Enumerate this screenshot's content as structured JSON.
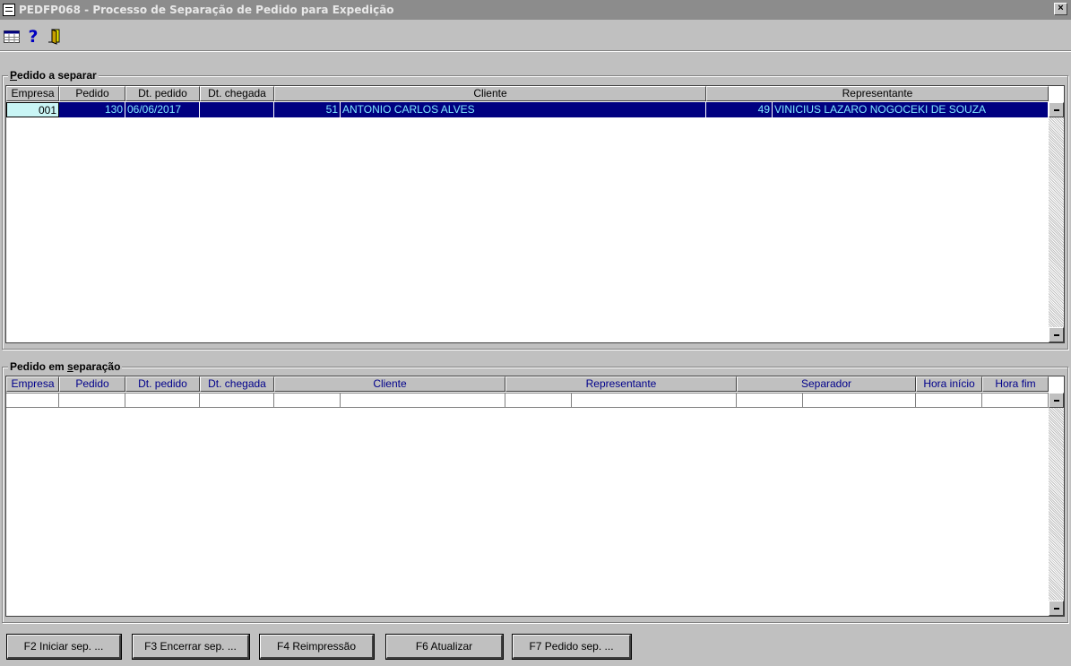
{
  "window": {
    "title": "PEDFP068 - Processo de Separação de Pedido para Expedição",
    "close_label": "×"
  },
  "toolbar": {
    "icons": [
      "grid-icon",
      "help-icon",
      "exit-door-icon"
    ],
    "help_glyph": "?"
  },
  "top_group": {
    "legend_prefix": "",
    "legend_underlined": "P",
    "legend_rest": "edido a separar",
    "columns": [
      "Empresa",
      "Pedido",
      "Dt. pedido",
      "Dt. chegada",
      "Cliente",
      "Representante"
    ],
    "rows": [
      {
        "empresa": "001",
        "pedido": "130",
        "dt_pedido": "06/06/2017",
        "dt_chegada": "",
        "cliente_cod": "51",
        "cliente_nome": "ANTONIO CARLOS ALVES",
        "rep_cod": "49",
        "rep_nome": "VINICIUS LAZARO NOGOCEKI DE SOUZA"
      }
    ]
  },
  "bottom_group": {
    "legend_prefix": "Pedido em ",
    "legend_underlined": "s",
    "legend_rest": "eparação",
    "columns": [
      "Empresa",
      "Pedido",
      "Dt. pedido",
      "Dt. chegada",
      "Cliente",
      "Representante",
      "Separador",
      "Hora início",
      "Hora fim"
    ]
  },
  "buttons": [
    "F2 Iniciar sep. ...",
    "F3 Encerrar sep. ...",
    "F4 Reimpressão",
    "F6 Atualizar",
    "F7 Pedido sep. ..."
  ],
  "colors": {
    "selection_bg": "#000080",
    "selection_text": "#7fe7ff",
    "header_text_bottom": "#00008b",
    "focus_cell": "#c9f5f5"
  }
}
